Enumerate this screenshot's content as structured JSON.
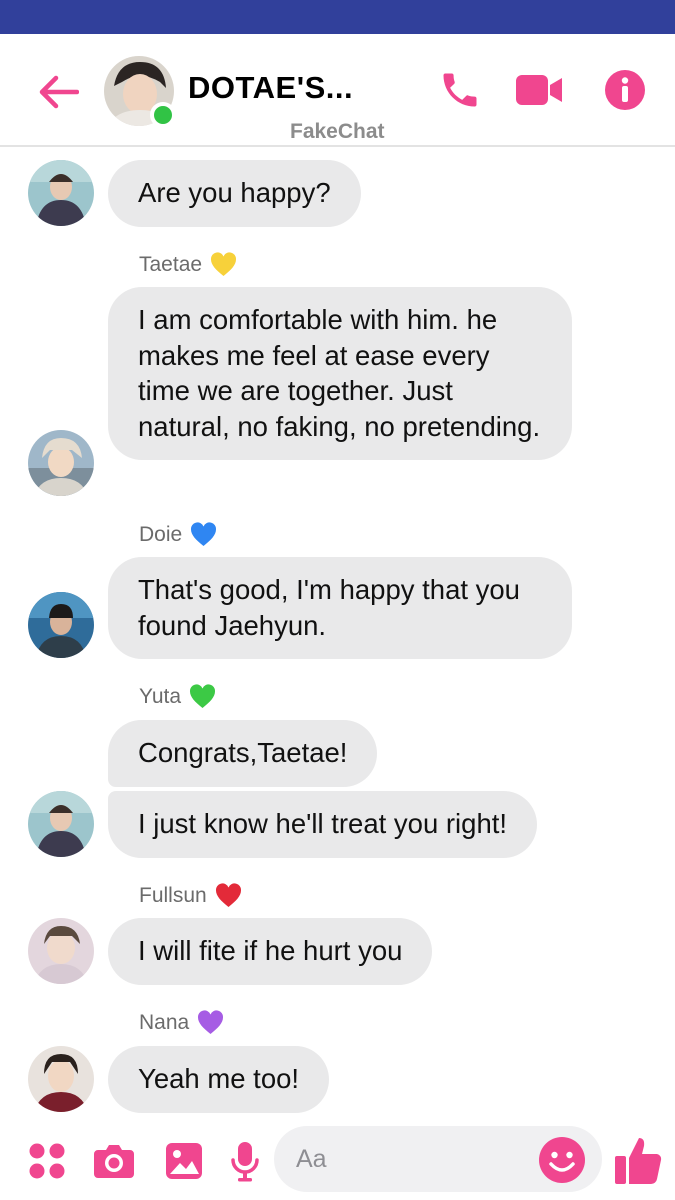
{
  "app": {
    "accent_color": "#f0468f",
    "status_bar_color": "#31409b",
    "bubble_color": "#e9e9ea"
  },
  "header": {
    "back_icon": "arrow-left-icon",
    "title": "DOTAE'S...",
    "watermark": "FakeChat",
    "online_status_color": "#31c345",
    "icons": [
      "phone-icon",
      "video-camera-icon",
      "info-icon"
    ]
  },
  "messages": [
    {
      "sender": null,
      "text": "Are you happy?"
    },
    {
      "sender": "Taetae",
      "heart_color": "#f7d13a",
      "text": "I am comfortable with him. he makes me feel at ease every time we are together. Just natural, no faking, no pretending."
    },
    {
      "sender": "Doie",
      "heart_color": "#2f86f2",
      "text": "That's good, I'm happy that you found Jaehyun."
    },
    {
      "sender": "Yuta",
      "heart_color": "#3cc945",
      "text": "Congrats,Taetae!"
    },
    {
      "sender": null,
      "text": "I just know he'll treat you right!"
    },
    {
      "sender": "Fullsun",
      "heart_color": "#e32a39",
      "text": "I will fite if he hurt you"
    },
    {
      "sender": "Nana",
      "heart_color": "#a65ce4",
      "text": "Yeah me too!"
    }
  ],
  "composer": {
    "placeholder": "Aa",
    "icons": [
      "apps-grid-icon",
      "camera-icon",
      "gallery-icon",
      "microphone-icon",
      "emoji-icon",
      "thumbs-up-icon"
    ]
  }
}
